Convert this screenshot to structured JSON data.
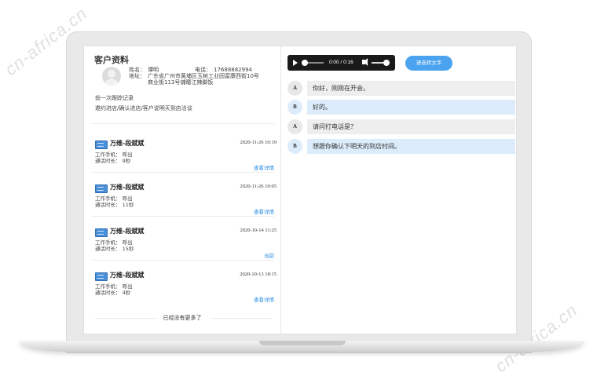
{
  "watermark": "cn-africa.cn",
  "customer": {
    "title": "客户资料",
    "name_label": "姓名：",
    "name": "谭明",
    "phone_label": "电话：",
    "phone": "17688882994",
    "address_label": "地址：",
    "address_line1": "广东省广州市黄埔区玉树工业园富康西街10号",
    "address_line2": "商业街113号铺瞳江辣脚饭",
    "last_follow_label": "前一次跟踪记录",
    "last_follow_text": "邀约进店/确认进店/客户说明天到店洽谈"
  },
  "records": [
    {
      "name": "万维-段斌斌",
      "time": "2020-11-26 10:19",
      "line1": "工作手机：  呼出",
      "line2": "通话时长：  9秒",
      "link": "查看详情"
    },
    {
      "name": "万维-段斌斌",
      "time": "2020-11-26 10:05",
      "line1": "工作手机：  呼出",
      "line2": "通话时长：  11秒",
      "link": "查看详情"
    },
    {
      "name": "万维-段斌斌",
      "time": "2020-10-14 11:25",
      "line1": "工作手机：  呼出",
      "line2": "通话时长：  15秒",
      "link": "当前"
    },
    {
      "name": "万维-段斌斌",
      "time": "2020-10-13 18:15",
      "line1": "工作手机：  呼出",
      "line2": "通话时长：  4秒",
      "link": "查看详情"
    }
  ],
  "no_more": "已经没有更多了",
  "player": {
    "time": "0:00 / 0:16",
    "progress": 0.0,
    "volume": 0.85
  },
  "convert_button": "语音转文字",
  "transcript": [
    {
      "speaker": "A",
      "text": "你好，刚刚在开会。"
    },
    {
      "speaker": "B",
      "text": "好的。"
    },
    {
      "speaker": "A",
      "text": "请问打电话是？"
    },
    {
      "speaker": "B",
      "text": "想跟你确认下明天的到店时间。"
    }
  ],
  "colors": {
    "accent": "#4ba3f0",
    "link": "#2b8ee6",
    "bubble_a": "#eeeeee",
    "bubble_b": "#dcecfb"
  }
}
